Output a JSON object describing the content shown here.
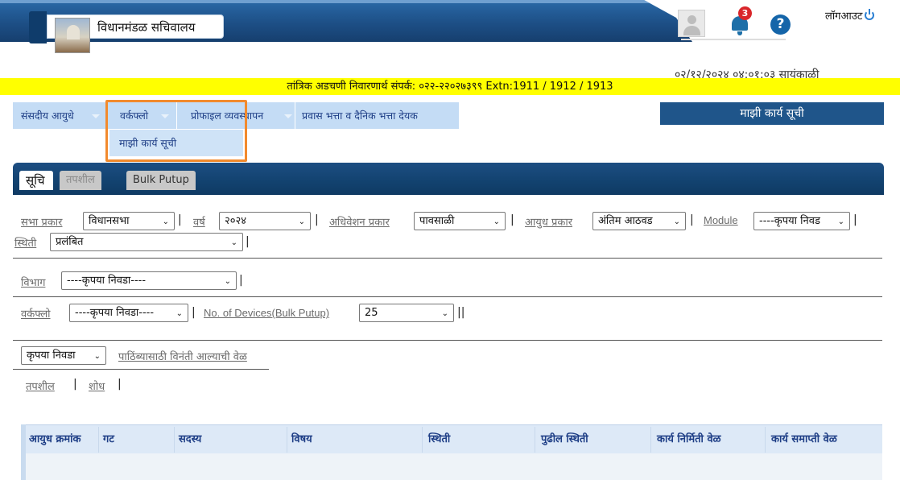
{
  "header": {
    "org_title": "विधानमंडळ सचिवालय",
    "notification_count": "3",
    "help_symbol": "?",
    "logout_label": "लॉगआउट",
    "datetime": "०२/१२/२०२४ ०४:०१:०३ सायंकाळी"
  },
  "helpline": "तांत्रिक अडचणी निवारणार्थ संपर्क: ०२२-२२०२७३९९ Extn:1911 / 1912 / 1913",
  "menu": {
    "items": [
      "संसदीय आयुधे",
      "वर्कफ्लो",
      "प्रोफाइल व्यवस्थापन",
      "प्रवास भत्ता व दैनिक भत्ता देयक"
    ],
    "dropdown_item": "माझी कार्य सूची",
    "right_title": "माझी कार्य सूची"
  },
  "tabs": [
    "सूचि",
    "तपशील",
    "Bulk Putup"
  ],
  "filters": {
    "sabha_label": "सभा प्रकार",
    "sabha_value": "विधानसभा",
    "year_label": "वर्ष",
    "year_value": "२०२४",
    "session_label": "अधिवेशन प्रकार",
    "session_value": "पावसाळी",
    "ayudh_label": "आयुध प्रकार",
    "ayudh_value": "अंतिम आठवड",
    "module_label": "Module",
    "module_value": "----कृपया निवड",
    "status_label": "स्थिती",
    "status_value": "प्रलंबित",
    "department_label": "विभाग",
    "department_value": "----कृपया निवडा----",
    "workflow_label": "वर्कफ्लो",
    "workflow_value": "----कृपया निवडा----",
    "devices_label": "No. of Devices(Bulk Putup)",
    "devices_value": "25",
    "sort_value": "कृपया निवडा",
    "sort_label": "पाठिंब्यासाठी विनंती आल्याची वेळ",
    "link_details": "तपशील",
    "link_search": "शोध"
  },
  "table": {
    "columns": [
      "आयुध क्रमांक",
      "गट",
      "सदस्य",
      "विषय",
      "स्थिती",
      "पुढील स्थिती",
      "कार्य निर्मिती वेळ",
      "कार्य समाप्ती वेळ"
    ]
  },
  "colors": {
    "helpline_bg": "#ffff00",
    "menu_bg": "#c4dcf5",
    "highlight": "#f28a2d",
    "panel_header": "#12426f",
    "badge": "#d9262a"
  }
}
